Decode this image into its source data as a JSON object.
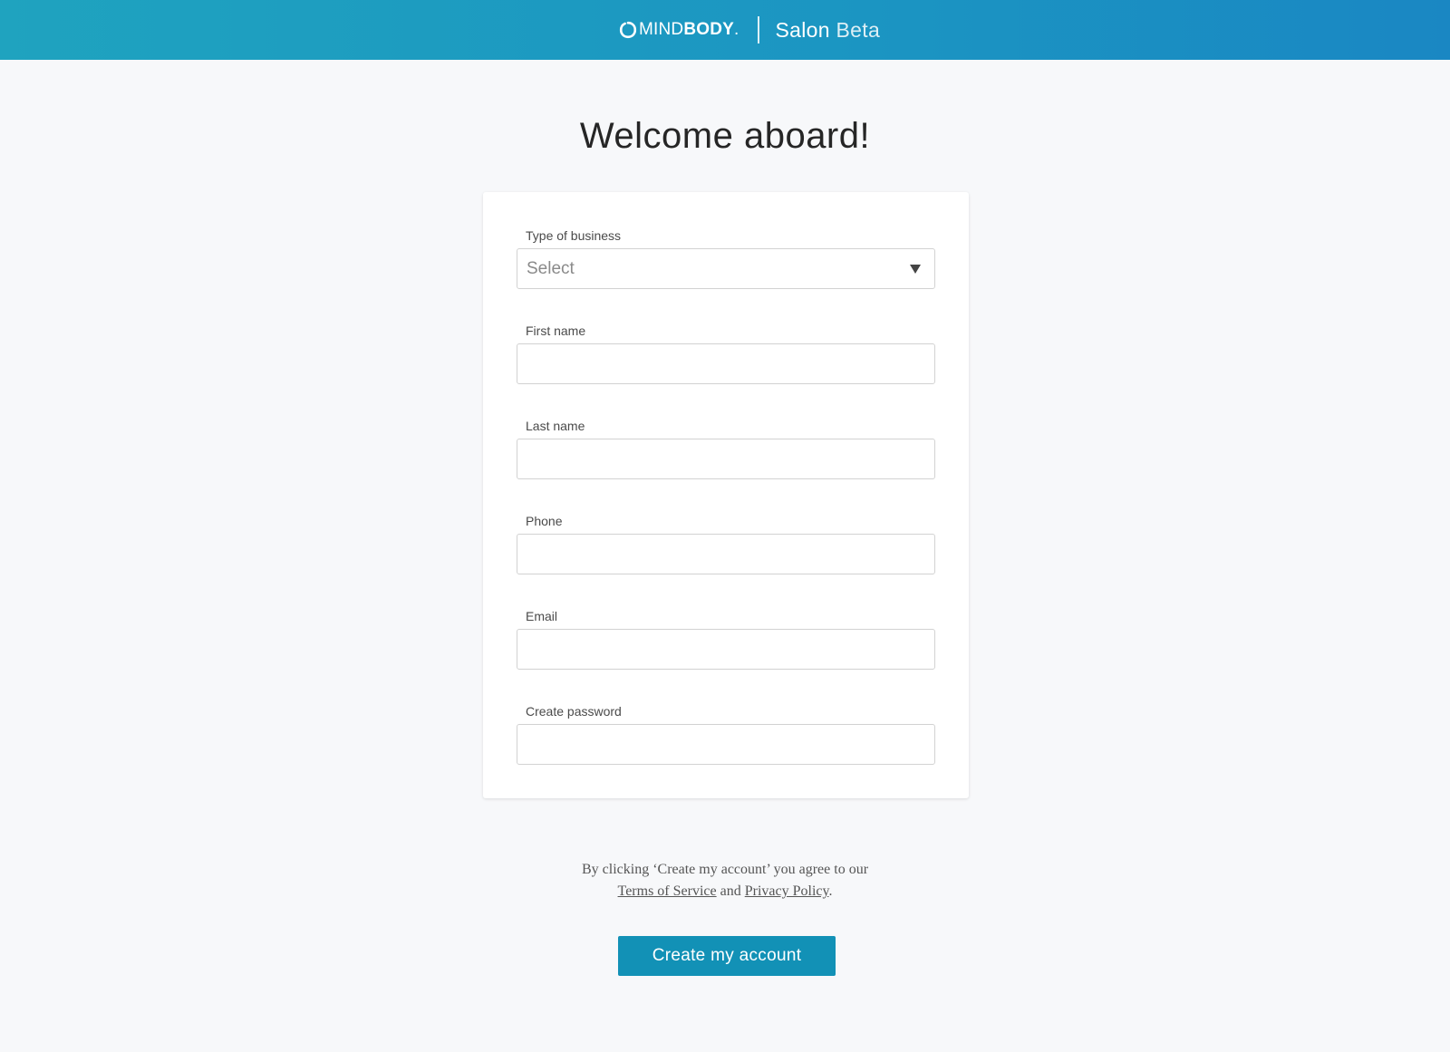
{
  "header": {
    "logo_light": "MIND",
    "logo_bold": "BODY",
    "logo_mark": ".",
    "product_name": "Salon",
    "product_tag": "Beta"
  },
  "page": {
    "title": "Welcome aboard!"
  },
  "form": {
    "business_type": {
      "label": "Type of business",
      "selected_value": "Select"
    },
    "first_name": {
      "label": "First name",
      "value": ""
    },
    "last_name": {
      "label": "Last name",
      "value": ""
    },
    "phone": {
      "label": "Phone",
      "value": ""
    },
    "email": {
      "label": "Email",
      "value": ""
    },
    "password": {
      "label": "Create password",
      "value": ""
    }
  },
  "legal": {
    "prefix": "By clicking ‘Create my account’ you agree to our",
    "terms_link": "Terms of Service",
    "and": "and",
    "privacy_link": "Privacy Policy",
    "suffix": "."
  },
  "actions": {
    "create_account_label": "Create my account"
  },
  "colors": {
    "header_gradient_start": "#1fa3bf",
    "header_gradient_end": "#1a87c3",
    "primary_button": "#1291b6",
    "page_background": "#f7f8fa"
  },
  "icons": {
    "logo": "mindbody-ring-icon",
    "dropdown": "caret-down-icon"
  }
}
